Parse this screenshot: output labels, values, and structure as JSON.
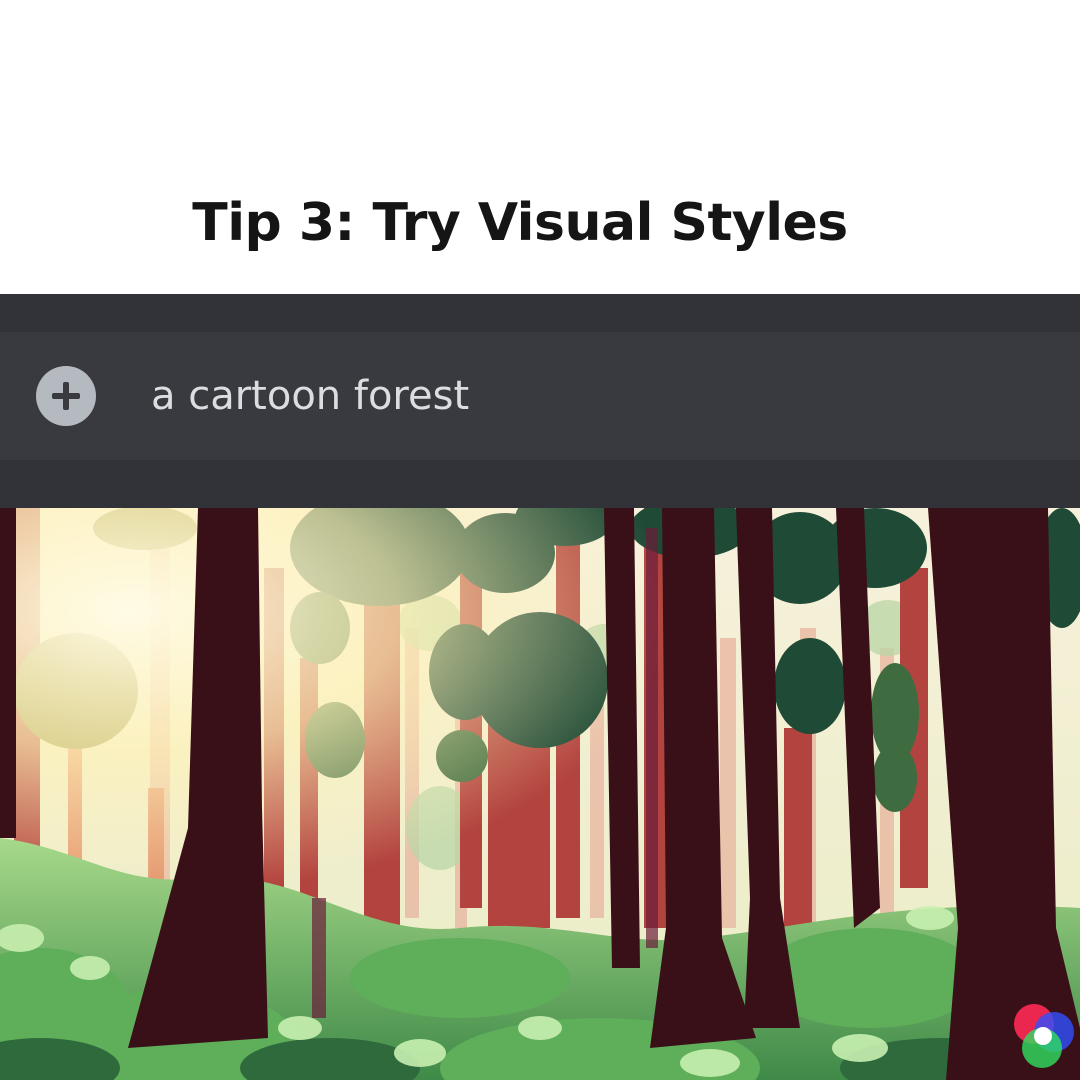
{
  "heading": {
    "title": "Tip 3: Try Visual Styles"
  },
  "chat": {
    "add_icon": "plus-circle-icon",
    "message_text": "a cartoon forest"
  },
  "colors": {
    "chat_background": "#313338",
    "input_background": "#383a40",
    "input_text": "#dbdee1",
    "add_button": "#b5bac1"
  },
  "image": {
    "subject": "cartoon-forest-illustration"
  },
  "watermark": {
    "icon": "rgb-circles-logo-icon"
  }
}
